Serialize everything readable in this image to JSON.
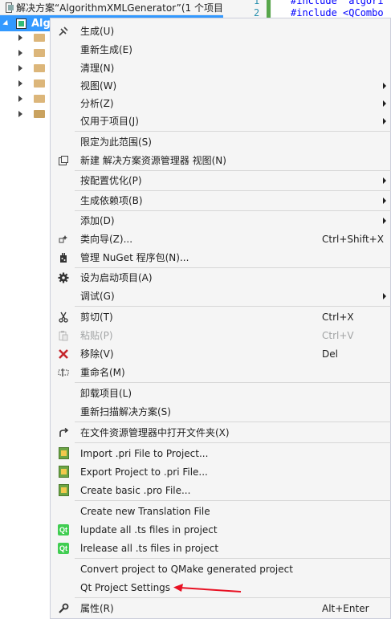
{
  "solution_explorer": {
    "header_text": "解决方案“AlgorithmXMLGenerator”(1 个项目",
    "project_label": "Alg"
  },
  "editor": {
    "line1_num": "1",
    "line2_num": "2",
    "line1_code": "#include \"algori",
    "line2_code": "#include <QCombo"
  },
  "menu": {
    "build": "生成(U)",
    "rebuild": "重新生成(E)",
    "clean": "清理(N)",
    "view": "视图(W)",
    "analyze": "分析(Z)",
    "project_only": "仅用于项目(J)",
    "scope_to_this": "限定为此范围(S)",
    "new_view": "新建 解决方案资源管理器 视图(N)",
    "pgo": "按配置优化(P)",
    "build_dependencies": "生成依赖项(B)",
    "add": "添加(D)",
    "class_wizard": "类向导(Z)...",
    "class_wizard_shortcut": "Ctrl+Shift+X",
    "nuget": "管理 NuGet 程序包(N)...",
    "set_startup": "设为启动项目(A)",
    "debug": "调试(G)",
    "cut": "剪切(T)",
    "cut_shortcut": "Ctrl+X",
    "paste": "粘贴(P)",
    "paste_shortcut": "Ctrl+V",
    "remove": "移除(V)",
    "remove_shortcut": "Del",
    "rename": "重命名(M)",
    "unload": "卸载项目(L)",
    "rescan": "重新扫描解决方案(S)",
    "open_folder": "在文件资源管理器中打开文件夹(X)",
    "import_pri": "Import .pri File to Project...",
    "export_pri": "Export Project to .pri File...",
    "create_pro": "Create basic .pro File...",
    "create_translation": "Create new Translation File",
    "lupdate": "lupdate all .ts files in project",
    "lrelease": "lrelease all .ts files in project",
    "convert_qmake": "Convert project to QMake generated project",
    "qt_settings": "Qt Project Settings",
    "properties": "属性(R)",
    "properties_shortcut": "Alt+Enter"
  },
  "colors": {
    "selection": "#3399ff",
    "annotation_arrow": "#e81123"
  }
}
